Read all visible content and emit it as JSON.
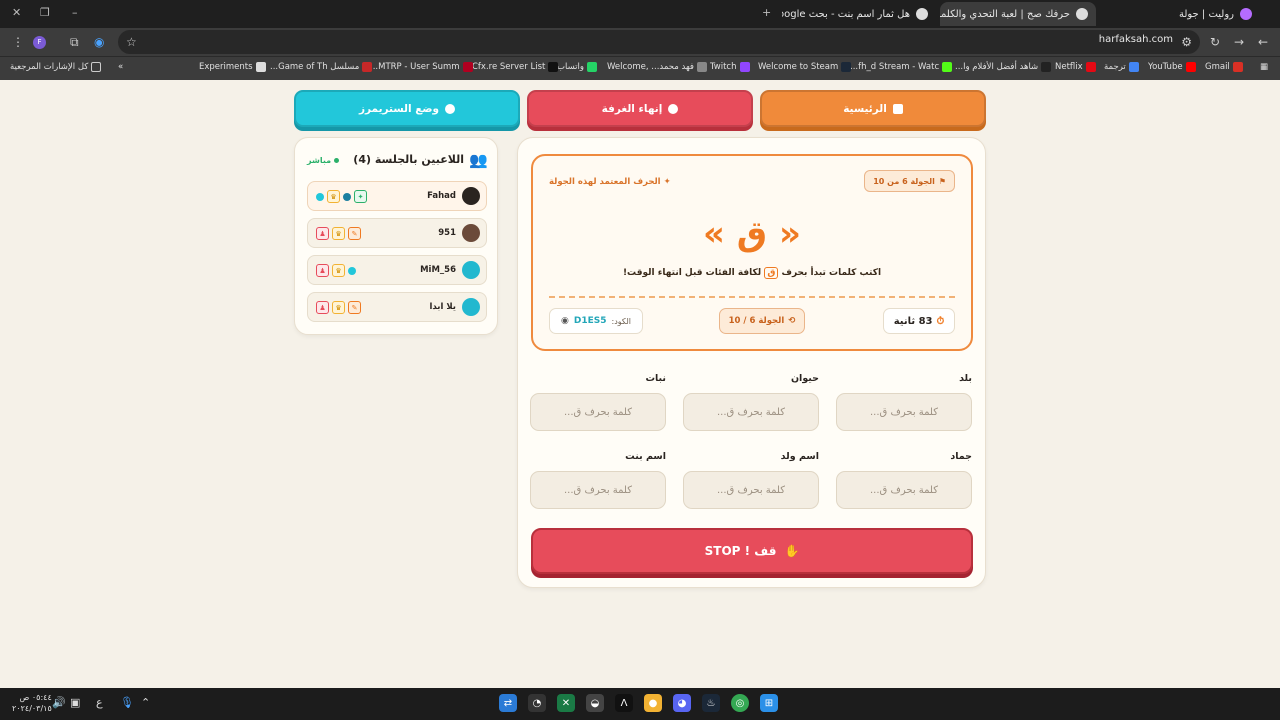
{
  "browser": {
    "tabs": [
      {
        "title": "روليت | جولة",
        "active": false
      },
      {
        "title": "حرفك صح | لعبة التحدي والكلمات",
        "active": true
      },
      {
        "title": "هل ثمار اسم بنت - بحث Google",
        "active": false
      }
    ],
    "new_tab": "+",
    "url": "harfaksah.com",
    "profile_initial": "F",
    "bookmarks": [
      {
        "label": "Gmail",
        "color": "#d93025"
      },
      {
        "label": "YouTube",
        "color": "#ff0000"
      },
      {
        "label": "ترجمة",
        "color": "#4285f4"
      },
      {
        "label": "Netflix",
        "color": "#e50914"
      },
      {
        "label": "شاهد أفضل الأفلام وا...",
        "color": "#222222"
      },
      {
        "label": "fh_d Stream - Watc...",
        "color": "#53fc18"
      },
      {
        "label": "Welcome to Steam",
        "color": "#1b2838"
      },
      {
        "label": "Twitch",
        "color": "#9146ff"
      },
      {
        "label": "فهد محمد... ,Welcome",
        "color": "#888888"
      },
      {
        "label": "واتساب",
        "color": "#25d366"
      },
      {
        "label": "Cfx.re Server List",
        "color": "#111111"
      },
      {
        "label": "MTRP - User Summ...",
        "color": "#b00020"
      },
      {
        "label": "مسلسل Game of Th...",
        "color": "#c62828"
      },
      {
        "label": "Experiments",
        "color": "#dddddd"
      }
    ],
    "all_bookmarks": "كل الإشارات المرجعية"
  },
  "nav": {
    "home": "الرئيسية",
    "leave": "إنهاء الغرفة",
    "stream_mode": "وضع الستريمرز"
  },
  "players": {
    "title": "اللاعبين بالجلسة (4)",
    "live": "مباشر",
    "list": [
      {
        "name": "Fahad",
        "avatar_color": "#2a2420",
        "me": true,
        "badges": [
          "crown",
          "gift",
          "dot"
        ]
      },
      {
        "name": "951",
        "avatar_color": "#6b4a3a",
        "me": false,
        "badges": [
          "edit",
          "crown",
          "user"
        ]
      },
      {
        "name": "MiM_56",
        "avatar_color": "#22b8cf",
        "me": false,
        "badges": [
          "dot",
          "crown",
          "user"
        ]
      },
      {
        "name": "يلا ابدا",
        "avatar_color": "#22b8cf",
        "me": false,
        "badges": [
          "edit",
          "crown",
          "user"
        ]
      }
    ]
  },
  "round": {
    "chip": "الجولة 6 من 10",
    "approved_label": "الحرف المعتمد لهذه الجولة",
    "letter": "« ق »",
    "instruction_before": "اكتب كلمات تبدأ بحرف",
    "instruction_letter": "ق",
    "instruction_after": "لكافة الفئات قبل انتهاء الوقت!",
    "timer": "83 ثانية",
    "round_progress": "الجولة 6 / 10",
    "code_label": "الكود:",
    "code_value": "D1ES5"
  },
  "categories": [
    {
      "label": "بلد",
      "placeholder": "كلمة بحرف ق...",
      "value": ""
    },
    {
      "label": "حيوان",
      "placeholder": "كلمة بحرف ق...",
      "value": ""
    },
    {
      "label": "نبات",
      "placeholder": "كلمة بحرف ق...",
      "value": ""
    },
    {
      "label": "جماد",
      "placeholder": "كلمة بحرف ق...",
      "value": ""
    },
    {
      "label": "اسم ولد",
      "placeholder": "كلمة بحرف ق...",
      "value": ""
    },
    {
      "label": "اسم بنت",
      "placeholder": "كلمة بحرف ق...",
      "value": ""
    }
  ],
  "stop_button": "قف ! STOP",
  "taskbar": {
    "time": "٠٥:٤٤ ص",
    "date": "٢٠٢٤/٠٣/١٥",
    "lang": "ع"
  },
  "colors": {
    "accent_orange": "#ef7a22",
    "accent_red": "#e74c5b",
    "accent_cyan": "#22c7da",
    "page_bg": "#f5f1e8"
  }
}
